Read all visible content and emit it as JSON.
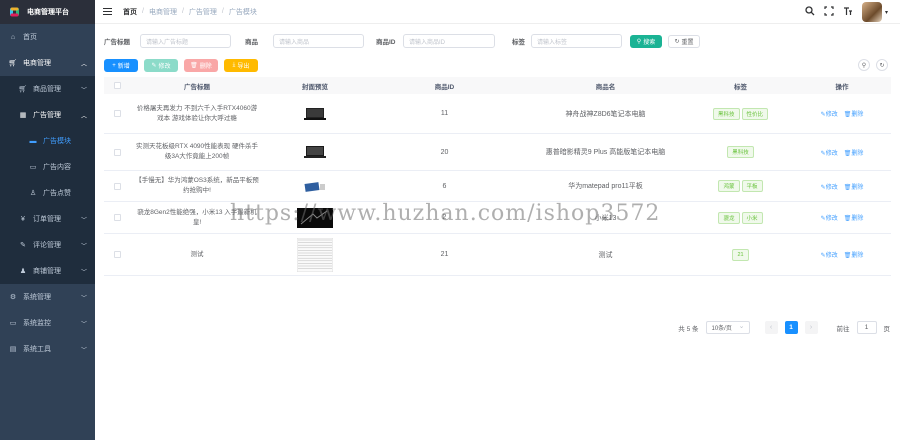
{
  "app": {
    "title": "电商管理平台"
  },
  "sidebar": {
    "items": [
      {
        "label": "首页",
        "icon": "dashboard-icon"
      },
      {
        "label": "电商管理",
        "icon": "cart-icon"
      },
      {
        "label": "商品管理",
        "icon": "cart-icon"
      },
      {
        "label": "广告管理",
        "icon": "ad-icon"
      },
      {
        "label": "广告模块",
        "icon": "module-icon"
      },
      {
        "label": "广告内容",
        "icon": "content-icon"
      },
      {
        "label": "广告点赞",
        "icon": "like-icon"
      },
      {
        "label": "订单管理",
        "icon": "order-icon"
      },
      {
        "label": "评论管理",
        "icon": "comment-icon"
      },
      {
        "label": "商铺管理",
        "icon": "shop-icon"
      },
      {
        "label": "系统管理",
        "icon": "system-icon"
      },
      {
        "label": "系统监控",
        "icon": "monitor-icon"
      },
      {
        "label": "系统工具",
        "icon": "tool-icon"
      }
    ]
  },
  "header": {
    "breadcrumb": [
      "首页",
      "电商管理",
      "广告管理",
      "广告模块"
    ]
  },
  "search": {
    "title_label": "广告标题",
    "title_placeholder": "请输入广告标题",
    "product_label": "商品",
    "product_placeholder": "请输入商品",
    "product_id_label": "商品ID",
    "product_id_placeholder": "请输入商品ID",
    "tag_label": "标签",
    "tag_placeholder": "请输入标签",
    "search_button": "搜索",
    "reset_button": "重置"
  },
  "toolbar": {
    "add": "新增",
    "edit": "修改",
    "delete": "删除",
    "export": "导出"
  },
  "table": {
    "columns": [
      "广告标题",
      "封面预览",
      "商品ID",
      "商品名",
      "标签",
      "操作"
    ],
    "edit_label": "修改",
    "delete_label": "删除",
    "rows": [
      {
        "title": "价格屠夫再发力 不到六千入手RTX4060游戏本 游戏体验让你大呼过瘾",
        "id": "11",
        "name": "神舟战神Z8D6笔记本电脑",
        "tags": [
          "黑科技",
          "性价比"
        ]
      },
      {
        "title": "实测天花板级RTX 4090性能表现 硬件杀手级3A大作竟能上200帧",
        "id": "20",
        "name": "惠普暗影精灵9 Plus 高能版笔记本电脑",
        "tags": [
          "黑科技"
        ]
      },
      {
        "title": "【手慢无】华为鸿蒙OS3系统，新品平板预约抢购中!",
        "id": "6",
        "name": "华为matepad pro11平板",
        "tags": [
          "鸿蒙",
          "平板"
        ]
      },
      {
        "title": "骁龙8Gen2性能绝强，小米13 入手最新机皇!",
        "id": "2",
        "name": "小米13",
        "tags": [
          "骁龙",
          "小米"
        ]
      },
      {
        "title": "测试",
        "id": "21",
        "name": "测试",
        "tags": [
          "21"
        ]
      }
    ]
  },
  "pagination": {
    "total": "共 5 条",
    "page_size": "10条/页",
    "current": "1",
    "goto_label": "前往",
    "goto_value": "1",
    "page_suffix": "页"
  },
  "watermark": "https://www.huzhan.com/ishop3572"
}
